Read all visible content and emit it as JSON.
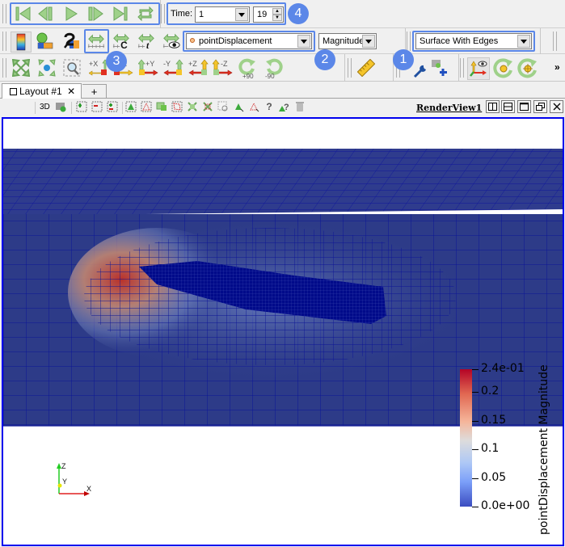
{
  "vcr_toolbar": {
    "buttons": [
      {
        "name": "first-frame",
        "icon": "first-frame-icon"
      },
      {
        "name": "previous-frame",
        "icon": "previous-frame-icon"
      },
      {
        "name": "play",
        "icon": "play-icon"
      },
      {
        "name": "next-frame",
        "icon": "next-frame-icon"
      },
      {
        "name": "last-frame",
        "icon": "last-frame-icon"
      },
      {
        "name": "loop",
        "icon": "loop-icon"
      }
    ]
  },
  "time_toolbar": {
    "label": "Time:",
    "time_value": "1",
    "step_value": "19"
  },
  "color_toolbar": {
    "array_selector": "pointDisplacement",
    "component_selector": "Magnitude"
  },
  "representation_toolbar": {
    "representation": "Surface With Edges"
  },
  "camera_toolbar": {
    "labels": {
      "plus_x": "+X",
      "minus_x": "-X",
      "plus_y": "+Y",
      "minus_y": "-Y",
      "plus_z": "+Z",
      "minus_z": "-Z",
      "rot_cw": "+90",
      "rot_ccw": "-90"
    },
    "overflow": "»"
  },
  "badges": {
    "b1": "1",
    "b2": "2",
    "b3": "3",
    "b4": "4"
  },
  "tabs": {
    "layout_tab": "Layout #1",
    "close": "✕",
    "add": "+"
  },
  "view_toolbar": {
    "toggle_3d": "3D",
    "view_name": "RenderView1",
    "query_label": "?"
  },
  "render_view": {
    "orientation_axes": {
      "x": "X",
      "y": "Y",
      "z": "Z"
    },
    "colors": {
      "mesh_edges": "#00008b",
      "low": "#3b4cc0",
      "mid": "#dddddd",
      "high": "#b40426"
    }
  },
  "color_legend": {
    "title": "pointDisplacement Magnitude",
    "range": [
      0.0,
      0.24
    ],
    "ticks": [
      {
        "value": 0.24,
        "label": "2.4e-01"
      },
      {
        "value": 0.2,
        "label": "0.2"
      },
      {
        "value": 0.15,
        "label": "0.15"
      },
      {
        "value": 0.1,
        "label": "0.1"
      },
      {
        "value": 0.05,
        "label": "0.05"
      },
      {
        "value": 0.0,
        "label": "0.0e+00"
      }
    ]
  }
}
